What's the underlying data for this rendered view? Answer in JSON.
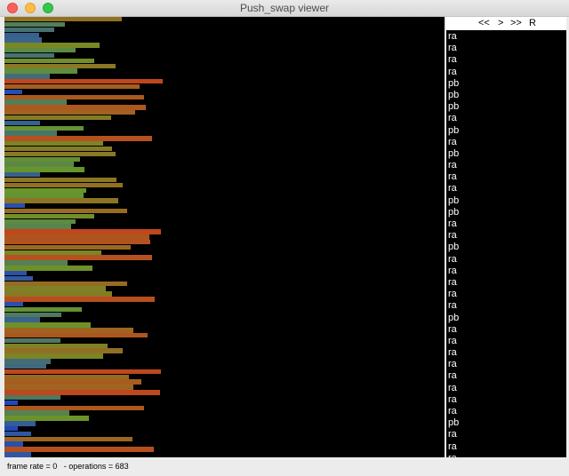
{
  "window": {
    "title": "Push_swap viewer"
  },
  "controls": {
    "rewind": "<<",
    "step": ">",
    "play": ">>",
    "reset": "R"
  },
  "operations": [
    "ra",
    "ra",
    "ra",
    "ra",
    "pb",
    "pb",
    "pb",
    "ra",
    "pb",
    "ra",
    "pb",
    "ra",
    "ra",
    "ra",
    "pb",
    "pb",
    "ra",
    "ra",
    "pb",
    "ra",
    "ra",
    "ra",
    "ra",
    "ra",
    "pb",
    "ra",
    "ra",
    "ra",
    "ra",
    "ra",
    "ra",
    "ra",
    "ra",
    "pb",
    "ra",
    "ra",
    "ra"
  ],
  "status": {
    "frame_rate_label": "frame rate = 0",
    "operations_label": "- operations = 683"
  },
  "colors": {
    "low": "#1a3fcf",
    "high": "#c0461c"
  },
  "stack_a_levels": [
    0.73,
    0.36,
    0.29,
    0.19,
    0.21,
    0.59,
    0.43,
    0.29,
    0.55,
    0.69,
    0.44,
    0.26,
    1.0,
    0.85,
    0.08,
    0.88,
    0.37,
    0.89,
    0.82,
    0.66,
    0.2,
    0.48,
    0.31,
    0.93,
    0.61,
    0.67,
    0.69,
    0.46,
    0.42,
    0.49,
    0.2,
    0.7,
    0.74,
    0.5,
    0.48,
    0.71,
    0.1,
    0.77,
    0.55,
    0.43,
    0.4,
    0.99,
    0.91,
    0.92,
    0.79,
    0.6,
    0.93,
    0.38,
    0.54,
    0.11,
    0.15,
    0.77,
    0.63,
    0.67,
    0.95,
    0.09,
    0.47,
    0.34,
    0.2,
    0.53,
    0.81,
    0.9,
    0.33,
    0.64,
    0.74,
    0.61,
    0.27,
    0.24,
    0.99,
    0.78,
    0.86,
    0.81,
    0.98,
    0.33,
    0.05,
    0.88,
    0.39,
    0.52,
    0.17,
    0.05,
    0.14,
    0.8,
    0.09,
    0.94,
    0.14
  ]
}
